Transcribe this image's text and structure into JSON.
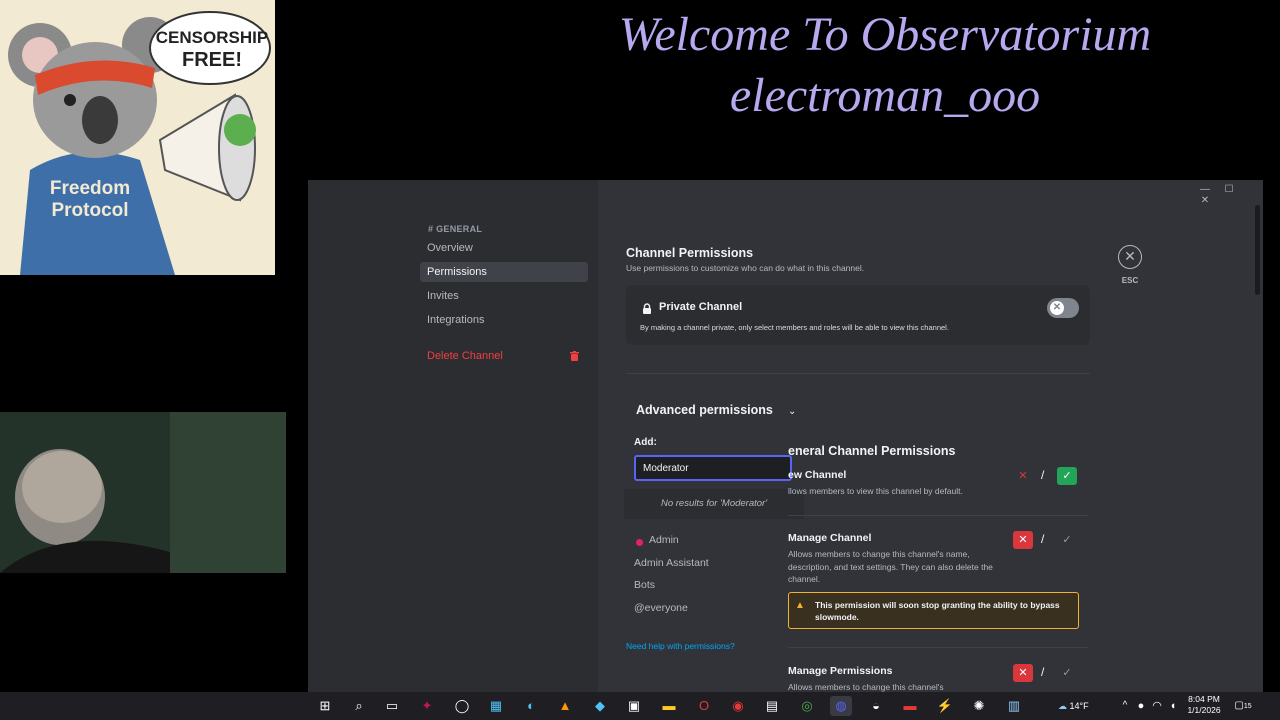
{
  "overlay": {
    "banner_line1": "Welcome To Observatorium",
    "banner_line2": "electroman_ooo",
    "koala_speech": "CENSORSHIP FREE!",
    "koala_shirt": "Freedom Protocol"
  },
  "window_controls": {
    "minimize": "—",
    "maximize": "☐",
    "close": "✕"
  },
  "sidebar": {
    "header": "# GENERAL",
    "items": [
      {
        "label": "Overview"
      },
      {
        "label": "Permissions"
      },
      {
        "label": "Invites"
      },
      {
        "label": "Integrations"
      }
    ],
    "delete_label": "Delete Channel"
  },
  "close": {
    "icon": "✕",
    "label": "ESC"
  },
  "main": {
    "title": "Channel Permissions",
    "subtitle": "Use permissions to customize who can do what in this channel.",
    "private": {
      "title": "Private Channel",
      "desc": "By making a channel private, only select members and roles will be able to view this channel.",
      "enabled": false
    },
    "advanced_label": "Advanced permissions",
    "add_label": "Add:",
    "search_value": "Moderator",
    "no_results": "No results for 'Moderator'",
    "roles": [
      {
        "name": "Admin",
        "color": "#e91e63"
      },
      {
        "name": "Admin Assistant"
      },
      {
        "name": "Bots"
      },
      {
        "name": "@everyone"
      }
    ],
    "help_link": "Need help with permissions?",
    "section_title": "eneral Channel Permissions",
    "permissions": [
      {
        "name": "ew Channel",
        "desc": "llows members to view this channel by default.",
        "state": "allow"
      },
      {
        "name": "Manage Channel",
        "desc": "Allows members to change this channel's name, description, and text settings. They can also delete the channel.",
        "state": "deny"
      },
      {
        "name": "Manage Permissions",
        "desc": "Allows members to change this channel's",
        "state": "deny"
      }
    ],
    "warning": "This permission will soon stop granting the ability to bypass slowmode."
  },
  "taskbar": {
    "weather": "14°F",
    "time": "8:04 PM",
    "date": "1/1/2026",
    "notifications": "15"
  },
  "colors": {
    "accent": "#5865f2",
    "danger": "#da373c",
    "success": "#23a559",
    "warning": "#f0b232"
  }
}
